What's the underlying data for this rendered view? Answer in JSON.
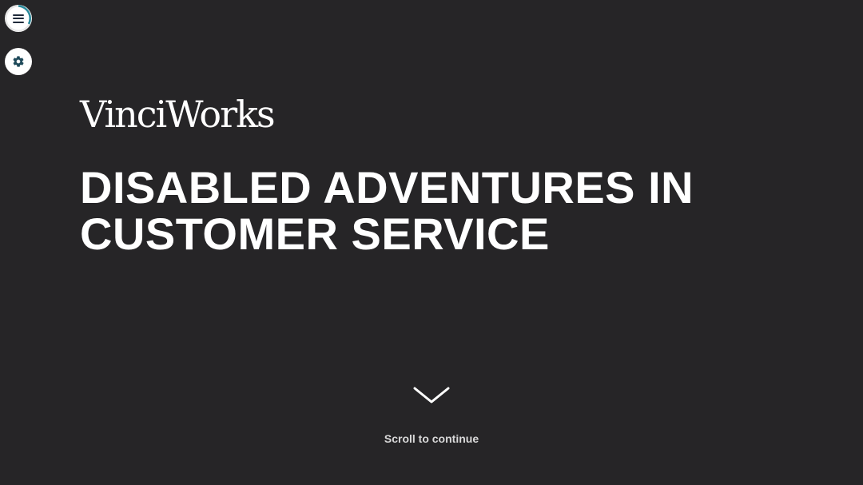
{
  "header": {
    "menu_icon": "hamburger-icon",
    "settings_icon": "gear-icon"
  },
  "logo": {
    "text": "VinciWorks"
  },
  "title": {
    "line1": "DISABLED ADVENTURES IN",
    "line2": "CUSTOMER SERVICE"
  },
  "scroll": {
    "icon": "chevron-down-icon",
    "label": "Scroll to continue"
  },
  "colors": {
    "background": "#262527",
    "accent": "#2a8a9c",
    "text": "#ffffff"
  }
}
